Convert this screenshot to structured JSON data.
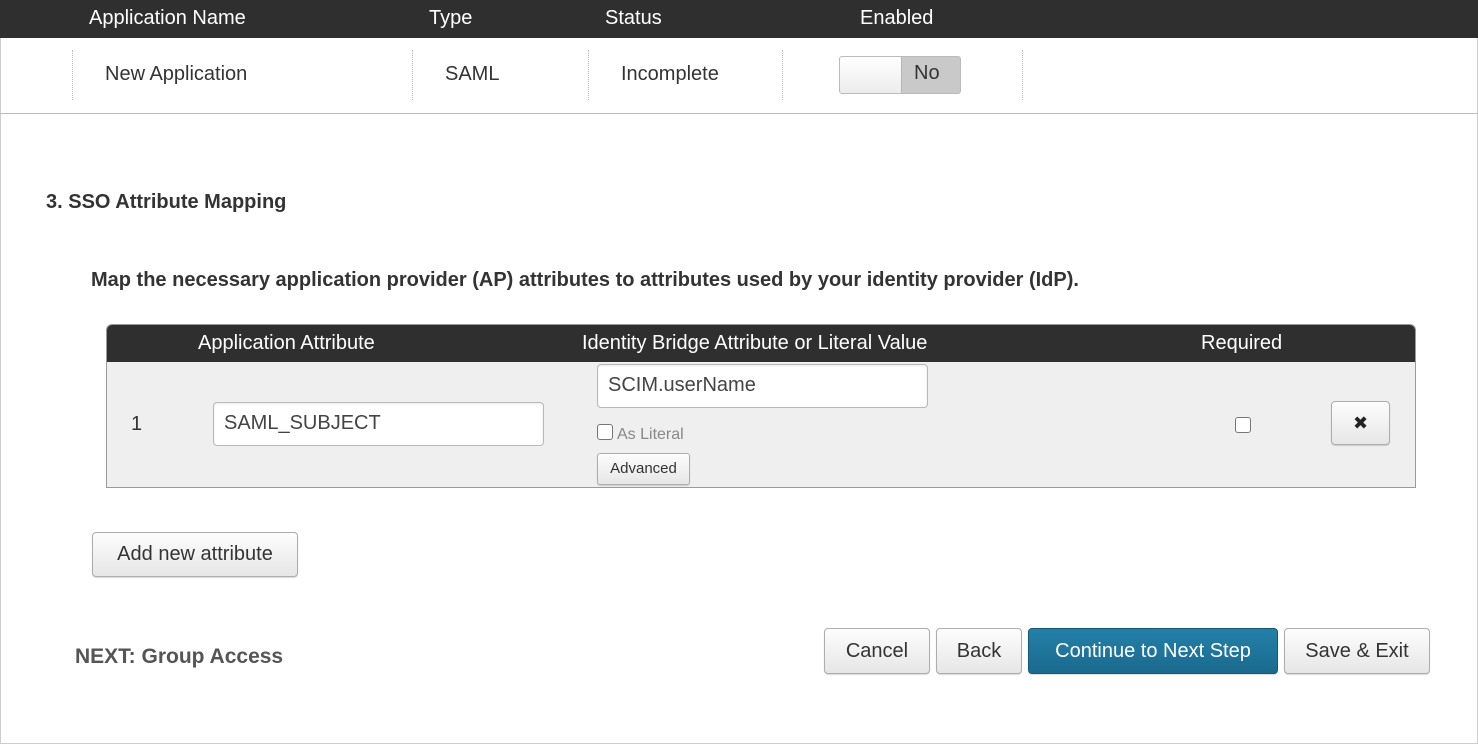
{
  "app_table": {
    "headers": {
      "name": "Application Name",
      "type": "Type",
      "status": "Status",
      "enabled": "Enabled"
    },
    "row": {
      "name": "New Application",
      "type": "SAML",
      "status": "Incomplete",
      "enabled_label": "No"
    }
  },
  "section": {
    "title": "3. SSO Attribute Mapping",
    "description": "Map the necessary application provider (AP) attributes to attributes used by your identity provider (IdP)."
  },
  "mapping_table": {
    "headers": {
      "app_attr": "Application Attribute",
      "idb_attr": "Identity Bridge Attribute or Literal Value",
      "required": "Required"
    },
    "rows": [
      {
        "index": "1",
        "app_attribute": "SAML_SUBJECT",
        "idb_attribute": "SCIM.userName",
        "as_literal_label": "As Literal",
        "advanced_label": "Advanced",
        "delete_glyph": "✖"
      }
    ]
  },
  "add_attribute_label": "Add new attribute",
  "next_label": "NEXT: Group Access",
  "footer_buttons": {
    "cancel": "Cancel",
    "back": "Back",
    "continue": "Continue to Next Step",
    "save_exit": "Save & Exit"
  },
  "colors": {
    "header_bg": "#2f2f2f",
    "primary": "#1a6a8e"
  }
}
